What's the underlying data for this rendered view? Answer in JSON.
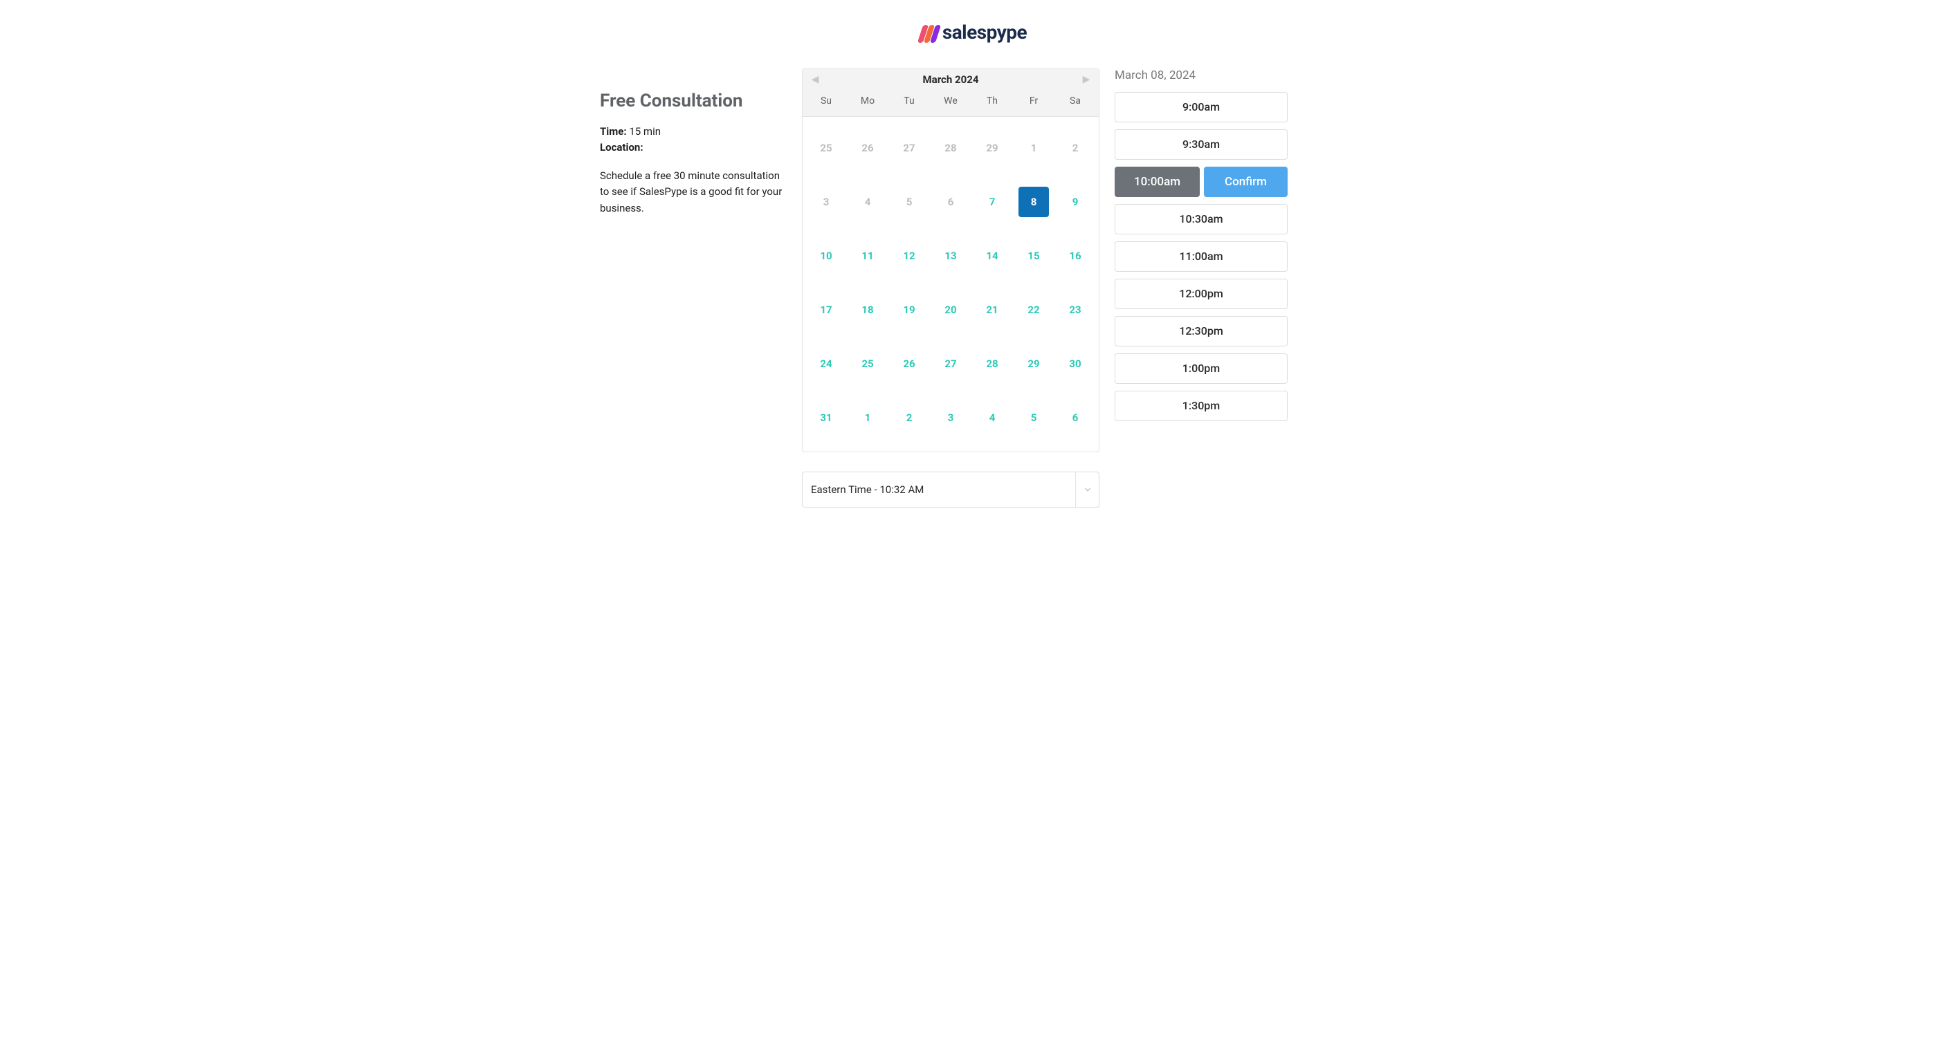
{
  "brand": {
    "name": "salespype"
  },
  "info": {
    "title": "Free Consultation",
    "time_label": "Time:",
    "time_value": "15 min",
    "location_label": "Location:",
    "location_value": "",
    "description": "Schedule a free 30 minute consultation to see if SalesPype is a good fit for your business."
  },
  "calendar": {
    "month_label": "March 2024",
    "dow": [
      "Su",
      "Mo",
      "Tu",
      "We",
      "Th",
      "Fr",
      "Sa"
    ],
    "weeks": [
      [
        {
          "d": "25",
          "state": "other"
        },
        {
          "d": "26",
          "state": "other"
        },
        {
          "d": "27",
          "state": "other"
        },
        {
          "d": "28",
          "state": "other"
        },
        {
          "d": "29",
          "state": "other"
        },
        {
          "d": "1",
          "state": "past"
        },
        {
          "d": "2",
          "state": "past"
        }
      ],
      [
        {
          "d": "3",
          "state": "past"
        },
        {
          "d": "4",
          "state": "past"
        },
        {
          "d": "5",
          "state": "past"
        },
        {
          "d": "6",
          "state": "past"
        },
        {
          "d": "7",
          "state": "avail",
          "dot": true
        },
        {
          "d": "8",
          "state": "selected"
        },
        {
          "d": "9",
          "state": "avail"
        }
      ],
      [
        {
          "d": "10",
          "state": "avail"
        },
        {
          "d": "11",
          "state": "avail"
        },
        {
          "d": "12",
          "state": "avail"
        },
        {
          "d": "13",
          "state": "avail"
        },
        {
          "d": "14",
          "state": "avail"
        },
        {
          "d": "15",
          "state": "avail"
        },
        {
          "d": "16",
          "state": "avail"
        }
      ],
      [
        {
          "d": "17",
          "state": "avail"
        },
        {
          "d": "18",
          "state": "avail"
        },
        {
          "d": "19",
          "state": "avail"
        },
        {
          "d": "20",
          "state": "avail"
        },
        {
          "d": "21",
          "state": "avail"
        },
        {
          "d": "22",
          "state": "avail"
        },
        {
          "d": "23",
          "state": "avail"
        }
      ],
      [
        {
          "d": "24",
          "state": "avail"
        },
        {
          "d": "25",
          "state": "avail"
        },
        {
          "d": "26",
          "state": "avail"
        },
        {
          "d": "27",
          "state": "avail"
        },
        {
          "d": "28",
          "state": "avail"
        },
        {
          "d": "29",
          "state": "avail"
        },
        {
          "d": "30",
          "state": "avail"
        }
      ],
      [
        {
          "d": "31",
          "state": "avail"
        },
        {
          "d": "1",
          "state": "avail"
        },
        {
          "d": "2",
          "state": "avail"
        },
        {
          "d": "3",
          "state": "avail"
        },
        {
          "d": "4",
          "state": "avail"
        },
        {
          "d": "5",
          "state": "avail"
        },
        {
          "d": "6",
          "state": "avail"
        }
      ]
    ]
  },
  "timezone": {
    "label": "Eastern Time - 10:32 AM"
  },
  "slots": {
    "date_label": "March 08, 2024",
    "confirm_label": "Confirm",
    "items": [
      {
        "time": "9:00am",
        "selected": false
      },
      {
        "time": "9:30am",
        "selected": false
      },
      {
        "time": "10:00am",
        "selected": true
      },
      {
        "time": "10:30am",
        "selected": false
      },
      {
        "time": "11:00am",
        "selected": false
      },
      {
        "time": "12:00pm",
        "selected": false
      },
      {
        "time": "12:30pm",
        "selected": false
      },
      {
        "time": "1:00pm",
        "selected": false
      },
      {
        "time": "1:30pm",
        "selected": false
      }
    ]
  }
}
